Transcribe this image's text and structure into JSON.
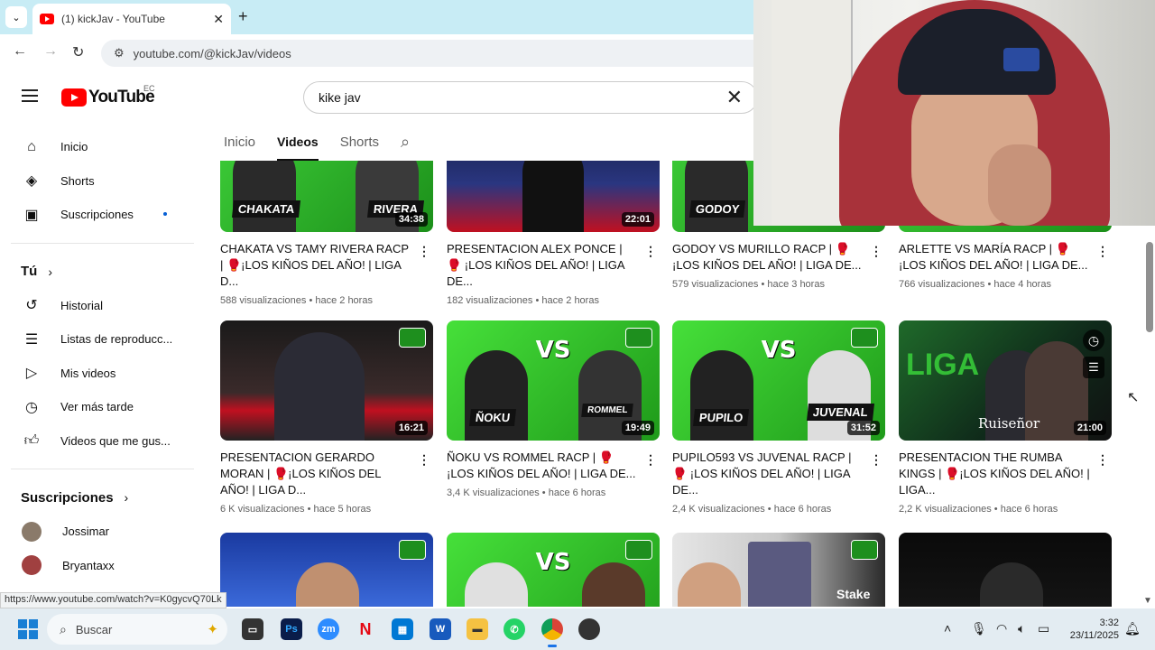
{
  "browser": {
    "tab_title": "(1) kickJav - YouTube",
    "url": "youtube.com/@kickJav/videos",
    "status_link": "https://www.youtube.com/watch?v=K0gycvQ70Lk"
  },
  "header": {
    "logo_text": "YouTube",
    "country": "EC",
    "search_value": "kike jav"
  },
  "sidebar": {
    "main": [
      {
        "label": "Inicio",
        "icon": "home-icon"
      },
      {
        "label": "Shorts",
        "icon": "shorts-icon"
      },
      {
        "label": "Suscripciones",
        "icon": "subscriptions-icon"
      }
    ],
    "you_header": "Tú",
    "you": [
      {
        "label": "Historial",
        "icon": "history-icon"
      },
      {
        "label": "Listas de reproducc...",
        "icon": "playlist-icon"
      },
      {
        "label": "Mis videos",
        "icon": "my-videos-icon"
      },
      {
        "label": "Ver más tarde",
        "icon": "watch-later-icon"
      },
      {
        "label": "Videos que me gus...",
        "icon": "like-icon"
      }
    ],
    "subs_header": "Suscripciones",
    "subs": [
      {
        "label": "Jossimar"
      },
      {
        "label": "Bryantaxx"
      }
    ]
  },
  "channel_tabs": [
    "Inicio",
    "Videos",
    "Shorts"
  ],
  "videos": [
    {
      "title": "CHAKATA VS TAMY RIVERA RACP | 🥊¡LOS KIÑOS DEL AÑO! | LIGA D...",
      "views": "588 visualizaciones",
      "age": "hace 2 horas",
      "duration": "34:38"
    },
    {
      "title": "PRESENTACION ALEX PONCE | 🥊 ¡LOS KIÑOS DEL AÑO! | LIGA DE...",
      "views": "182 visualizaciones",
      "age": "hace 2 horas",
      "duration": "22:01"
    },
    {
      "title": "GODOY VS MURILLO RACP | 🥊¡LOS KIÑOS DEL AÑO! | LIGA DE...",
      "views": "579 visualizaciones",
      "age": "hace 3 horas",
      "duration": ""
    },
    {
      "title": "ARLETTE VS MARÍA RACP | 🥊¡LOS KIÑOS DEL AÑO! | LIGA DE...",
      "views": "766 visualizaciones",
      "age": "hace 4 horas",
      "duration": ""
    },
    {
      "title": "PRESENTACION GERARDO MORAN | 🥊¡LOS KIÑOS DEL AÑO! | LIGA D...",
      "views": "6 K visualizaciones",
      "age": "hace 5 horas",
      "duration": "16:21"
    },
    {
      "title": "ÑOKU VS ROMMEL RACP | 🥊 ¡LOS KIÑOS DEL AÑO! | LIGA DE...",
      "views": "3,4 K visualizaciones",
      "age": "hace 6 horas",
      "duration": "19:49"
    },
    {
      "title": "PUPILO593 VS JUVENAL RACP | 🥊 ¡LOS KIÑOS DEL AÑO! | LIGA DE...",
      "views": "2,4 K visualizaciones",
      "age": "hace 6 horas",
      "duration": "31:52"
    },
    {
      "title": "PRESENTACION THE RUMBA KINGS | 🥊¡LOS KIÑOS DEL AÑO! | LIGA...",
      "views": "2,2 K visualizaciones",
      "age": "hace 6 horas",
      "duration": "21:00"
    }
  ],
  "thumb_text": {
    "t0_left": "CHAKATA",
    "t0_right": "RIVERA",
    "t2_name": "GODOY",
    "t5_left": "ÑOKU",
    "t5_right": "ROMMEL",
    "t6_left": "PUPILO",
    "t6_right": "JUVENAL",
    "t7_brand": "Ruiseñor",
    "vs": "VS",
    "liga": "LIGA",
    "stake": "Stake"
  },
  "taskbar": {
    "search_placeholder": "Buscar",
    "time": "3:32",
    "date": "23/11/2025"
  }
}
